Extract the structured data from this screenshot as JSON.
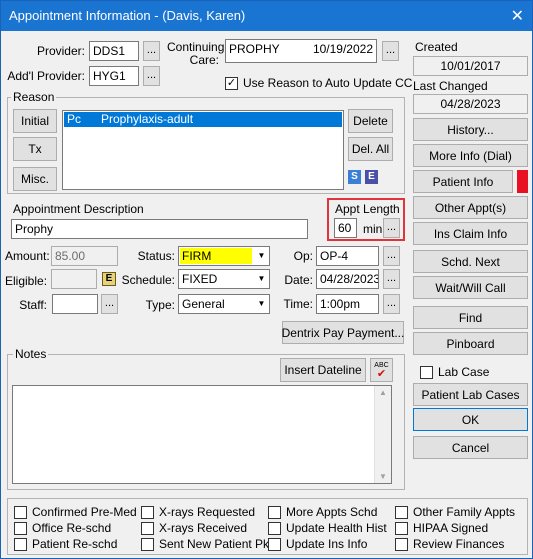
{
  "window": {
    "title": "Appointment Information - (Davis, Karen)",
    "close_glyph": "✕"
  },
  "provider": {
    "label": "Provider:",
    "value": "DDS1",
    "ellipsis": "..."
  },
  "addl_provider": {
    "label": "Add'l Provider:",
    "value": "HYG1",
    "ellipsis": "..."
  },
  "continuing_care": {
    "label_line1": "Continuing",
    "label_line2": "Care:",
    "type": "PROPHY",
    "date": "10/19/2022",
    "ellipsis": "..."
  },
  "use_reason": {
    "label": "Use Reason to Auto Update CC",
    "checked": true,
    "mark": "✓"
  },
  "created": {
    "label": "Created",
    "value": "10/01/2017"
  },
  "last_changed": {
    "label": "Last Changed",
    "value": "04/28/2023"
  },
  "reason": {
    "group_title": "Reason",
    "buttons": {
      "initial": "Initial",
      "tx": "Tx",
      "misc": "Misc.",
      "delete": "Delete",
      "del_all": "Del. All"
    },
    "items": [
      {
        "code": "Pc",
        "description": "Prophylaxis-adult"
      }
    ],
    "icons": {
      "s": "S",
      "e": "E"
    }
  },
  "appt_description": {
    "label": "Appointment Description",
    "value": "Prophy"
  },
  "appt_length": {
    "label": "Appt Length",
    "value": "60",
    "unit": "min",
    "ellipsis": "..."
  },
  "amount": {
    "label": "Amount:",
    "value": "85.00"
  },
  "eligible": {
    "label": "Eligible:",
    "value": "",
    "icon": "E"
  },
  "staff": {
    "label": "Staff:",
    "value": "",
    "ellipsis": "..."
  },
  "status": {
    "label": "Status:",
    "value": "FIRM",
    "color": "#ffff00"
  },
  "schedule": {
    "label": "Schedule:",
    "value": "FIXED"
  },
  "type": {
    "label": "Type:",
    "value": "General"
  },
  "op": {
    "label": "Op:",
    "value": "OP-4",
    "ellipsis": "..."
  },
  "date": {
    "label": "Date:",
    "value": "04/28/2023",
    "ellipsis": "..."
  },
  "time": {
    "label": "Time:",
    "value": "1:00pm",
    "ellipsis": "..."
  },
  "dentrix_pay": {
    "label": "Dentrix Pay Payment..."
  },
  "notes": {
    "group_title": "Notes",
    "insert_dateline": "Insert Dateline",
    "spell_icon": "ABC",
    "value": ""
  },
  "side_buttons": {
    "history": "History...",
    "more_info": "More Info (Dial)",
    "patient_info": "Patient Info",
    "patient_info_flag_color": "#e81123",
    "other_appts": "Other Appt(s)",
    "ins_claim_info": "Ins Claim Info",
    "schd_next": "Schd. Next",
    "wait_will_call": "Wait/Will Call",
    "find": "Find",
    "pinboard": "Pinboard",
    "lab_case": "Lab Case",
    "patient_lab_cases": "Patient Lab Cases",
    "ok": "OK",
    "cancel": "Cancel"
  },
  "bottom_checks": {
    "col1": [
      "Confirmed Pre-Med",
      "Office Re-schd",
      "Patient Re-schd"
    ],
    "col2": [
      "X-rays Requested",
      "X-rays Received",
      "Sent New Patient Pkg"
    ],
    "col3": [
      "More Appts Schd",
      "Update Health Hist",
      "Update Ins Info"
    ],
    "col4": [
      "Other Family Appts",
      "HIPAA Signed",
      "Review Finances"
    ]
  },
  "colors": {
    "title_bar": "#1a74d2",
    "selection": "#0078d7",
    "highlight_box": "#e0333a"
  }
}
